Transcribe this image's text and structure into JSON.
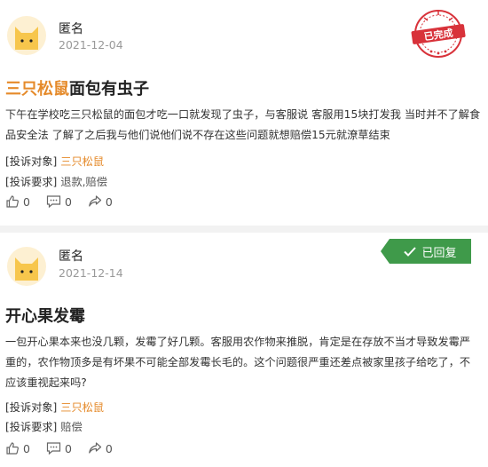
{
  "complaints": [
    {
      "user": "匿名",
      "date": "2021-12-04",
      "status": "已完成",
      "title_highlight": "三只松鼠",
      "title_rest": "面包有虫子",
      "body": "下午在学校吃三只松鼠的面包才吃一口就发现了虫子，与客服说 客服用15块打发我 当时并不了解食品安全法 了解了之后我与他们说他们说不存在这些问题就想赔偿15元就潦草结束",
      "target_label": "[投诉对象]",
      "target": "三只松鼠",
      "demand_label": "[投诉要求]",
      "demand": "退款,赔偿",
      "likes": "0",
      "comments": "0",
      "shares": "0"
    },
    {
      "user": "匿名",
      "date": "2021-12-14",
      "status": "已回复",
      "title": "开心果发霉",
      "body": "一包开心果本来也没几颗，发霉了好几颗。客服用农作物来推脱，肯定是在存放不当才导致发霉严重的，农作物顶多是有坏果不可能全部发霉长毛的。这个问题很严重还差点被家里孩子给吃了，不应该重视起来吗?",
      "target_label": "[投诉对象]",
      "target": "三只松鼠",
      "demand_label": "[投诉要求]",
      "demand": "赔偿",
      "likes": "0",
      "comments": "0",
      "shares": "0"
    }
  ],
  "colors": {
    "highlight": "#e58a2a",
    "stamp_red": "#d8323a",
    "replied_green": "#3f9a4a",
    "muted": "#999999"
  },
  "icons": [
    "cat-avatar-icon",
    "completed-stamp-icon",
    "checkmark-icon",
    "thumbs-up-icon",
    "comment-icon",
    "share-icon"
  ]
}
